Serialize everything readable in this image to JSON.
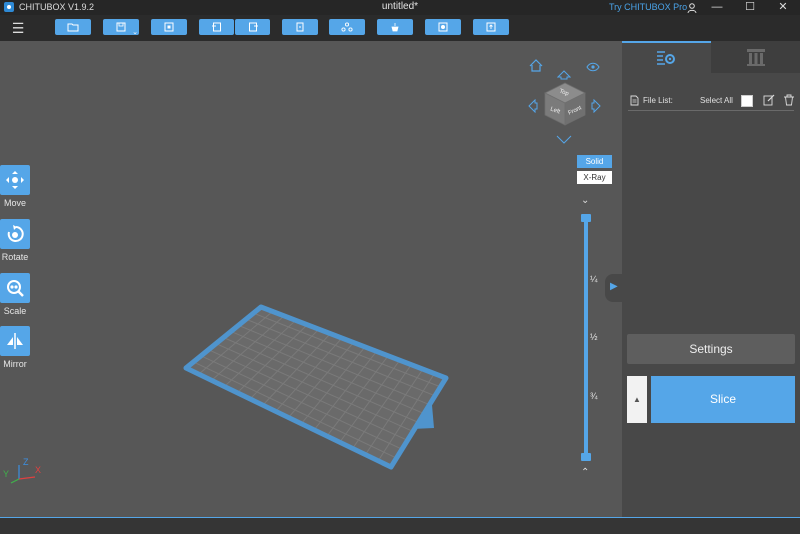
{
  "titlebar": {
    "app_name": "CHITUBOX V1.9.2",
    "document": "untitled*",
    "promo": "Try CHITUBOX Pro",
    "minimize": "—",
    "maximize": "☐",
    "close": "✕"
  },
  "toolbar": {
    "menu_icon": "☰",
    "buttons": [
      "open-folder-icon",
      "save-icon",
      "fit-screen-icon",
      "undo-icon",
      "redo-icon",
      "copy-icon",
      "layout-icon",
      "support-icon",
      "hollow-icon",
      "export-icon"
    ]
  },
  "left_tools": [
    {
      "label": "Move"
    },
    {
      "label": "Rotate"
    },
    {
      "label": "Scale"
    },
    {
      "label": "Mirror"
    }
  ],
  "view_mode": {
    "solid": "Solid",
    "xray": "X-Ray"
  },
  "cube_faces": {
    "top": "Top",
    "left": "Left",
    "front": "Front"
  },
  "layer_slider": {
    "q1": "¼",
    "q2": "½",
    "q3": "¾",
    "up": "⌃",
    "down": "⌄"
  },
  "axes": {
    "x": "X",
    "y": "Y",
    "z": "Z"
  },
  "panel": {
    "file_list": "File List:",
    "select_all": "Select All",
    "settings": "Settings",
    "slice": "Slice",
    "slice_menu": "▲",
    "collapse": "▶"
  },
  "colors": {
    "accent": "#55a6e8",
    "viewport": "#575757",
    "panel": "#484848"
  }
}
